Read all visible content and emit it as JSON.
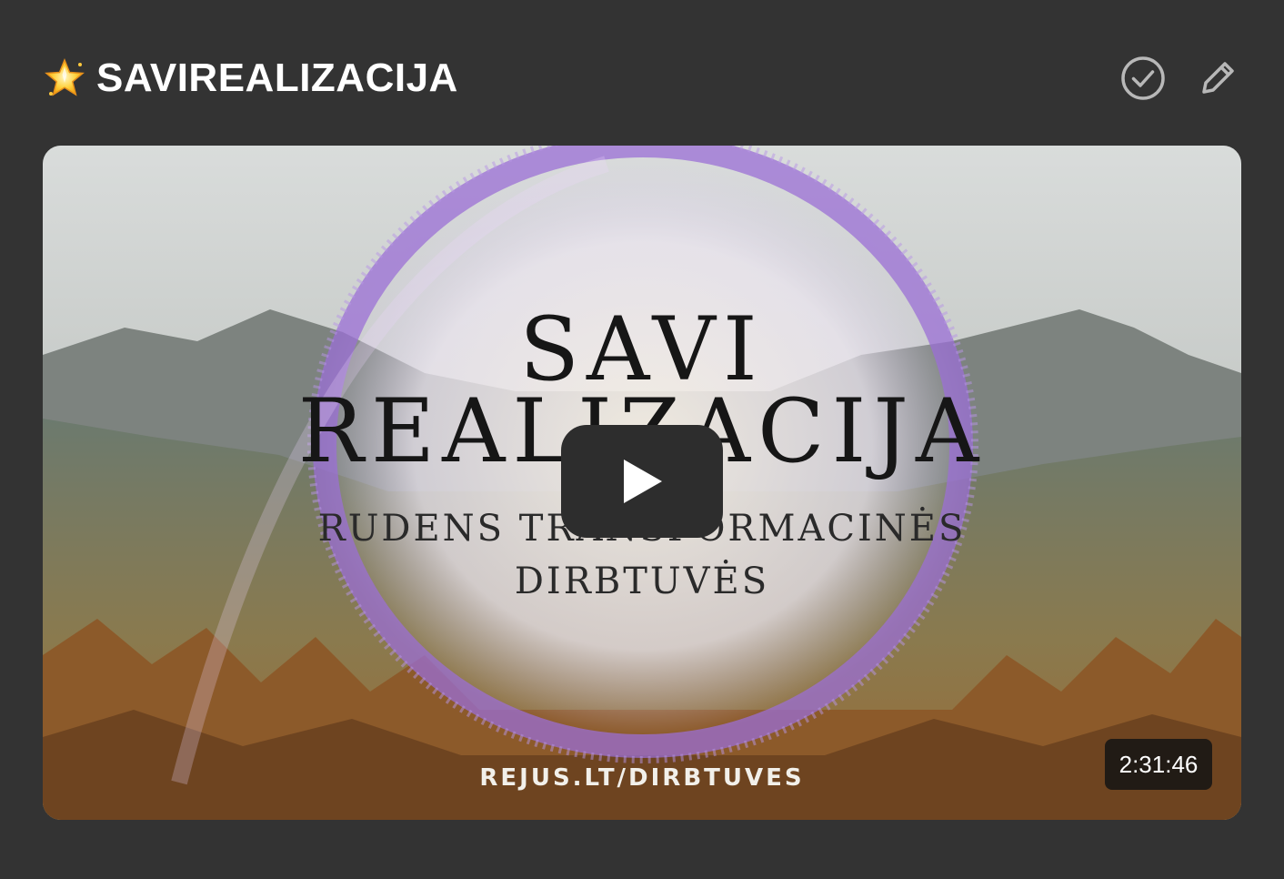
{
  "header": {
    "icon": "glowing-star-icon",
    "title": "SAVIREALIZACIJA",
    "actions": [
      {
        "name": "check-circle-icon",
        "label": "Mark done"
      },
      {
        "name": "pencil-icon",
        "label": "Edit"
      }
    ]
  },
  "video": {
    "thumbnail_text": {
      "line1": "SAVI",
      "line2": "REALIZACIJA",
      "line3": "RUDENS TRANSFORMACINĖS",
      "line4": "DIRBTUVĖS",
      "url": "REJUS.LT/DIRBTUVES"
    },
    "play_icon": "play-icon",
    "duration": "2:31:46"
  },
  "colors": {
    "background": "#333333",
    "title": "#ffffff",
    "icon": "#b8b8b8",
    "play_button": "#2d2d2d",
    "ring": "#9b6fd6"
  }
}
